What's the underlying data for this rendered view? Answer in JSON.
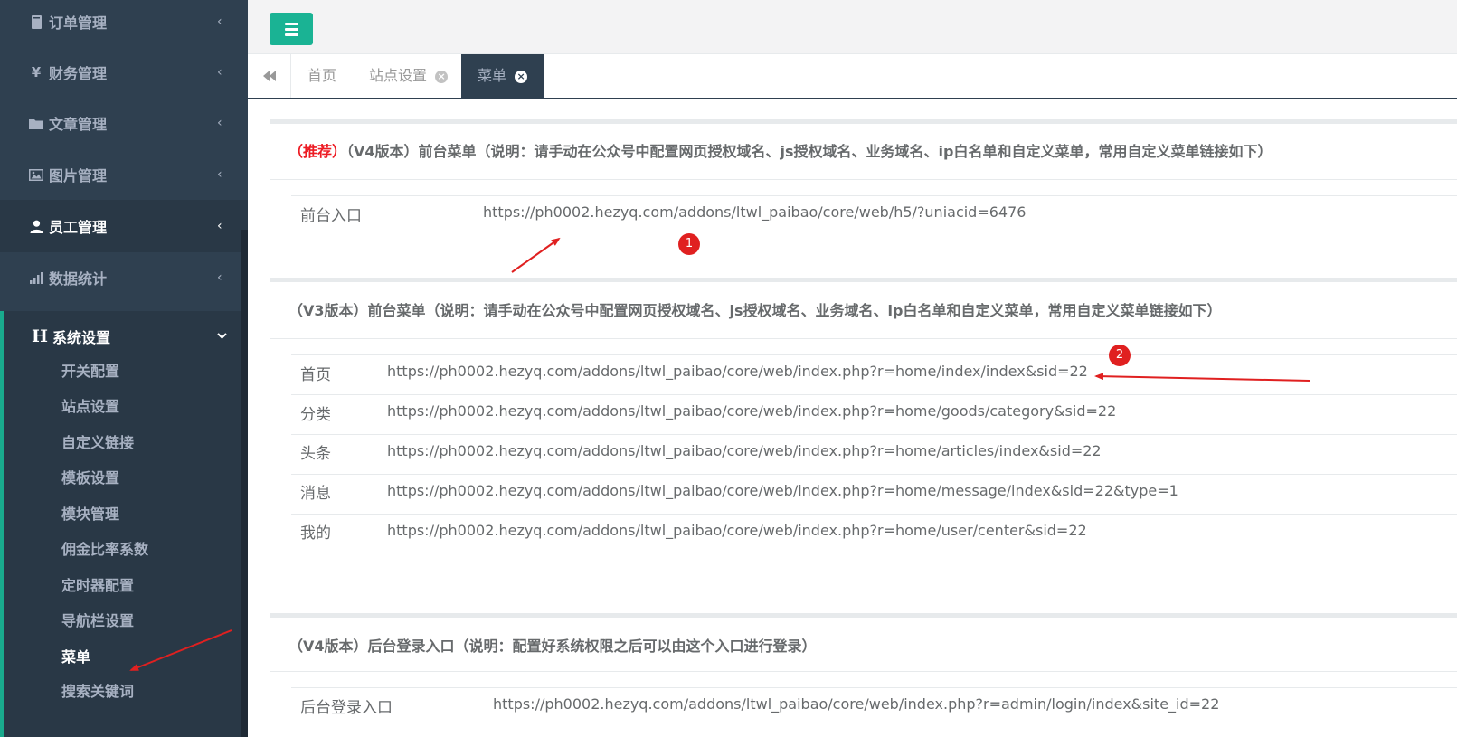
{
  "sidebar": {
    "items": [
      {
        "label": "订单管理",
        "icon": "book-icon"
      },
      {
        "label": "财务管理",
        "icon": "yen-icon"
      },
      {
        "label": "文章管理",
        "icon": "folder-icon"
      },
      {
        "label": "图片管理",
        "icon": "image-icon"
      },
      {
        "label": "员工管理",
        "icon": "user-icon"
      },
      {
        "label": "数据统计",
        "icon": "bar-chart-icon"
      }
    ],
    "system": {
      "label": "系统设置",
      "icon_text": "H",
      "sub_items": [
        "开关配置",
        "站点设置",
        "自定义链接",
        "模板设置",
        "模块管理",
        "佣金比率系数",
        "定时器配置",
        "导航栏设置",
        "菜单",
        "搜索关键词"
      ]
    }
  },
  "tabs": [
    {
      "label": "首页"
    },
    {
      "label": "站点设置"
    },
    {
      "label": "菜单"
    }
  ],
  "sections": {
    "v4": {
      "recommend": "（推荐）",
      "title": "（V4版本）前台菜单（说明：请手动在公众号中配置网页授权域名、js授权域名、业务域名、ip白名单和自定义菜单，常用自定义菜单链接如下）",
      "row": {
        "label": "前台入口",
        "url": "https://ph0002.hezyq.com/addons/ltwl_paibao/core/web/h5/?uniacid=6476"
      }
    },
    "v3": {
      "title": "（V3版本）前台菜单（说明：请手动在公众号中配置网页授权域名、js授权域名、业务域名、ip白名单和自定义菜单，常用自定义菜单链接如下）",
      "rows": [
        {
          "label": "首页",
          "url": "https://ph0002.hezyq.com/addons/ltwl_paibao/core/web/index.php?r=home/index/index&sid=22"
        },
        {
          "label": "分类",
          "url": "https://ph0002.hezyq.com/addons/ltwl_paibao/core/web/index.php?r=home/goods/category&sid=22"
        },
        {
          "label": "头条",
          "url": "https://ph0002.hezyq.com/addons/ltwl_paibao/core/web/index.php?r=home/articles/index&sid=22"
        },
        {
          "label": "消息",
          "url": "https://ph0002.hezyq.com/addons/ltwl_paibao/core/web/index.php?r=home/message/index&sid=22&type=1"
        },
        {
          "label": "我的",
          "url": "https://ph0002.hezyq.com/addons/ltwl_paibao/core/web/index.php?r=home/user/center&sid=22"
        }
      ]
    },
    "admin": {
      "title": "（V4版本）后台登录入口（说明：配置好系统权限之后可以由这个入口进行登录）",
      "row": {
        "label": "后台登录入口",
        "url": "https://ph0002.hezyq.com/addons/ltwl_paibao/core/web/index.php?r=admin/login/index&site_id=22"
      }
    }
  },
  "annotations": {
    "badge1": "1",
    "badge2": "2"
  },
  "colors": {
    "sidebar": "#2f4050",
    "accent": "#1ab394",
    "highlight": "#ed1c24"
  }
}
